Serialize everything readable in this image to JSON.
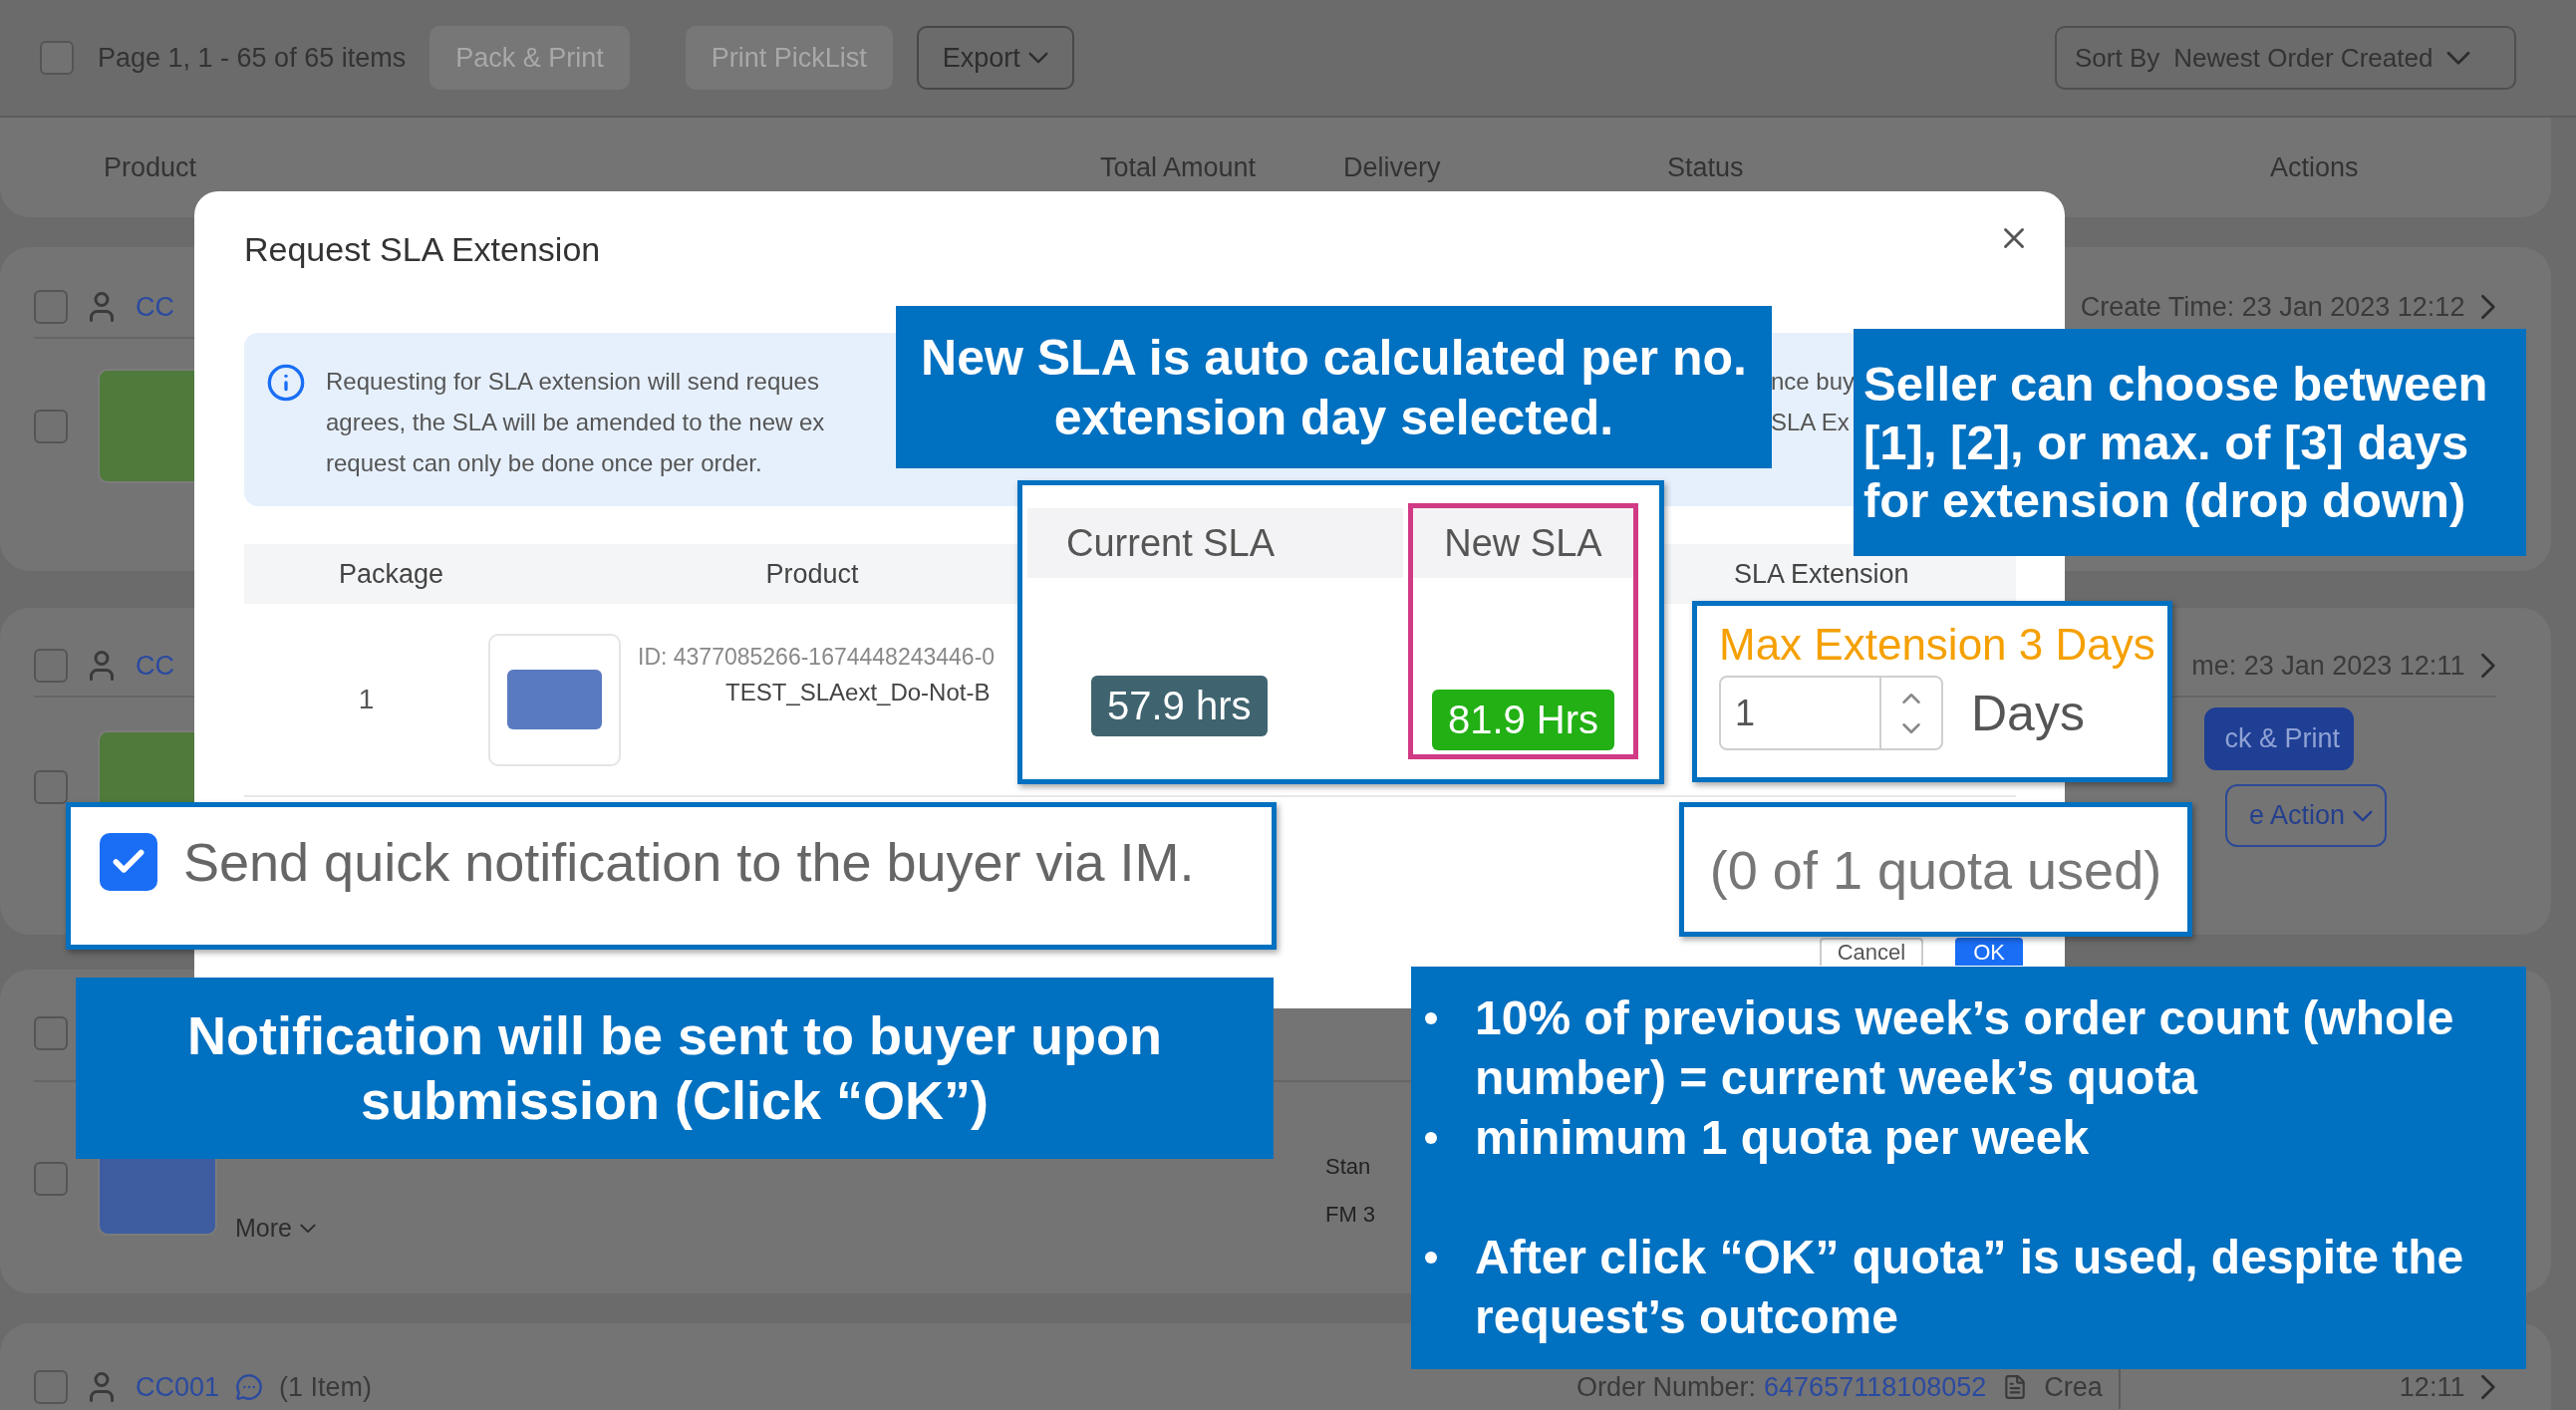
{
  "toolbar": {
    "checked": false,
    "page_info": "Page 1, 1 - 65 of 65 items",
    "buttons": [
      {
        "label": "Pack & Print",
        "disabled": true,
        "kind": "plain"
      },
      {
        "label": "Print PickList",
        "disabled": true,
        "kind": "plain"
      },
      {
        "label": "Export",
        "disabled": false,
        "kind": "dropdown"
      }
    ],
    "sort": {
      "label": "Sort By",
      "value": "Newest Order Created"
    }
  },
  "columns": [
    "Product",
    "Total Amount",
    "Delivery",
    "Status",
    "Actions"
  ],
  "orders": [
    {
      "checked": false,
      "product_checked": false,
      "buyer": "CC",
      "time": "Create Time: 23 Jan 2023 12:12"
    },
    {
      "checked": false,
      "product_checked": false,
      "buyer": "CC",
      "time": "me: 23 Jan 2023 12:11",
      "actions": [
        {
          "label": "ck & Print",
          "kind": "primary"
        },
        {
          "label": "e Action",
          "kind": "dropdown"
        }
      ]
    },
    {
      "checked": false,
      "product_checked": false,
      "details": [
        "Stan",
        "FM 3"
      ],
      "more": "More"
    },
    {
      "checked": false,
      "buyer": "CC001",
      "items": "(1 Item)",
      "order_label": "Order Number:",
      "order_number": "647657118108052",
      "created": "Crea",
      "time": "12:11"
    }
  ],
  "modal": {
    "title": "Request SLA Extension",
    "info": {
      "lines": [
        "Requesting for SLA extension will send reques",
        "agrees, the SLA will be amended to the new ex",
        "request can only be done once per order."
      ],
      "fragments": [
        "nce buy",
        "SLA Ex"
      ]
    },
    "table": {
      "columns": [
        "Package",
        "Product",
        "SLA Extension"
      ],
      "row": {
        "package": "1",
        "id": "ID: 4377085266-1674448243446-0",
        "name": "TEST_SLAext_Do-Not-B"
      }
    },
    "buttons": [
      {
        "label": "Cancel",
        "primary": false
      },
      {
        "label": "OK",
        "primary": true
      }
    ]
  },
  "sla_zoom": {
    "columns": [
      {
        "label": "Current SLA",
        "value": "57.9 hrs",
        "highlighted": false
      },
      {
        "label": "New SLA",
        "value": "81.9 Hrs",
        "highlighted": true
      }
    ]
  },
  "extension_zoom": {
    "label": "Max Extension 3 Days",
    "value": "1",
    "unit": "Days"
  },
  "notify_zoom": {
    "label": "Send quick notification to the buyer via IM.",
    "checked": true
  },
  "quota_zoom": {
    "text": "(0 of 1 quota used)"
  },
  "notes": [
    {
      "text": "New SLA is auto calculated per no. extension day selected."
    },
    {
      "text": "Seller can choose between [1], [2], or max. of [3] days for extension (drop down)"
    },
    {
      "text": "Notification will be sent to buyer upon submission (Click “OK”)"
    }
  ],
  "quota_note": {
    "groups": [
      [
        "10% of previous week’s order count (whole number) = current week’s quota",
        "minimum 1 quota per week"
      ],
      [
        "After click “OK” quota” is used, despite the request’s outcome"
      ]
    ]
  }
}
